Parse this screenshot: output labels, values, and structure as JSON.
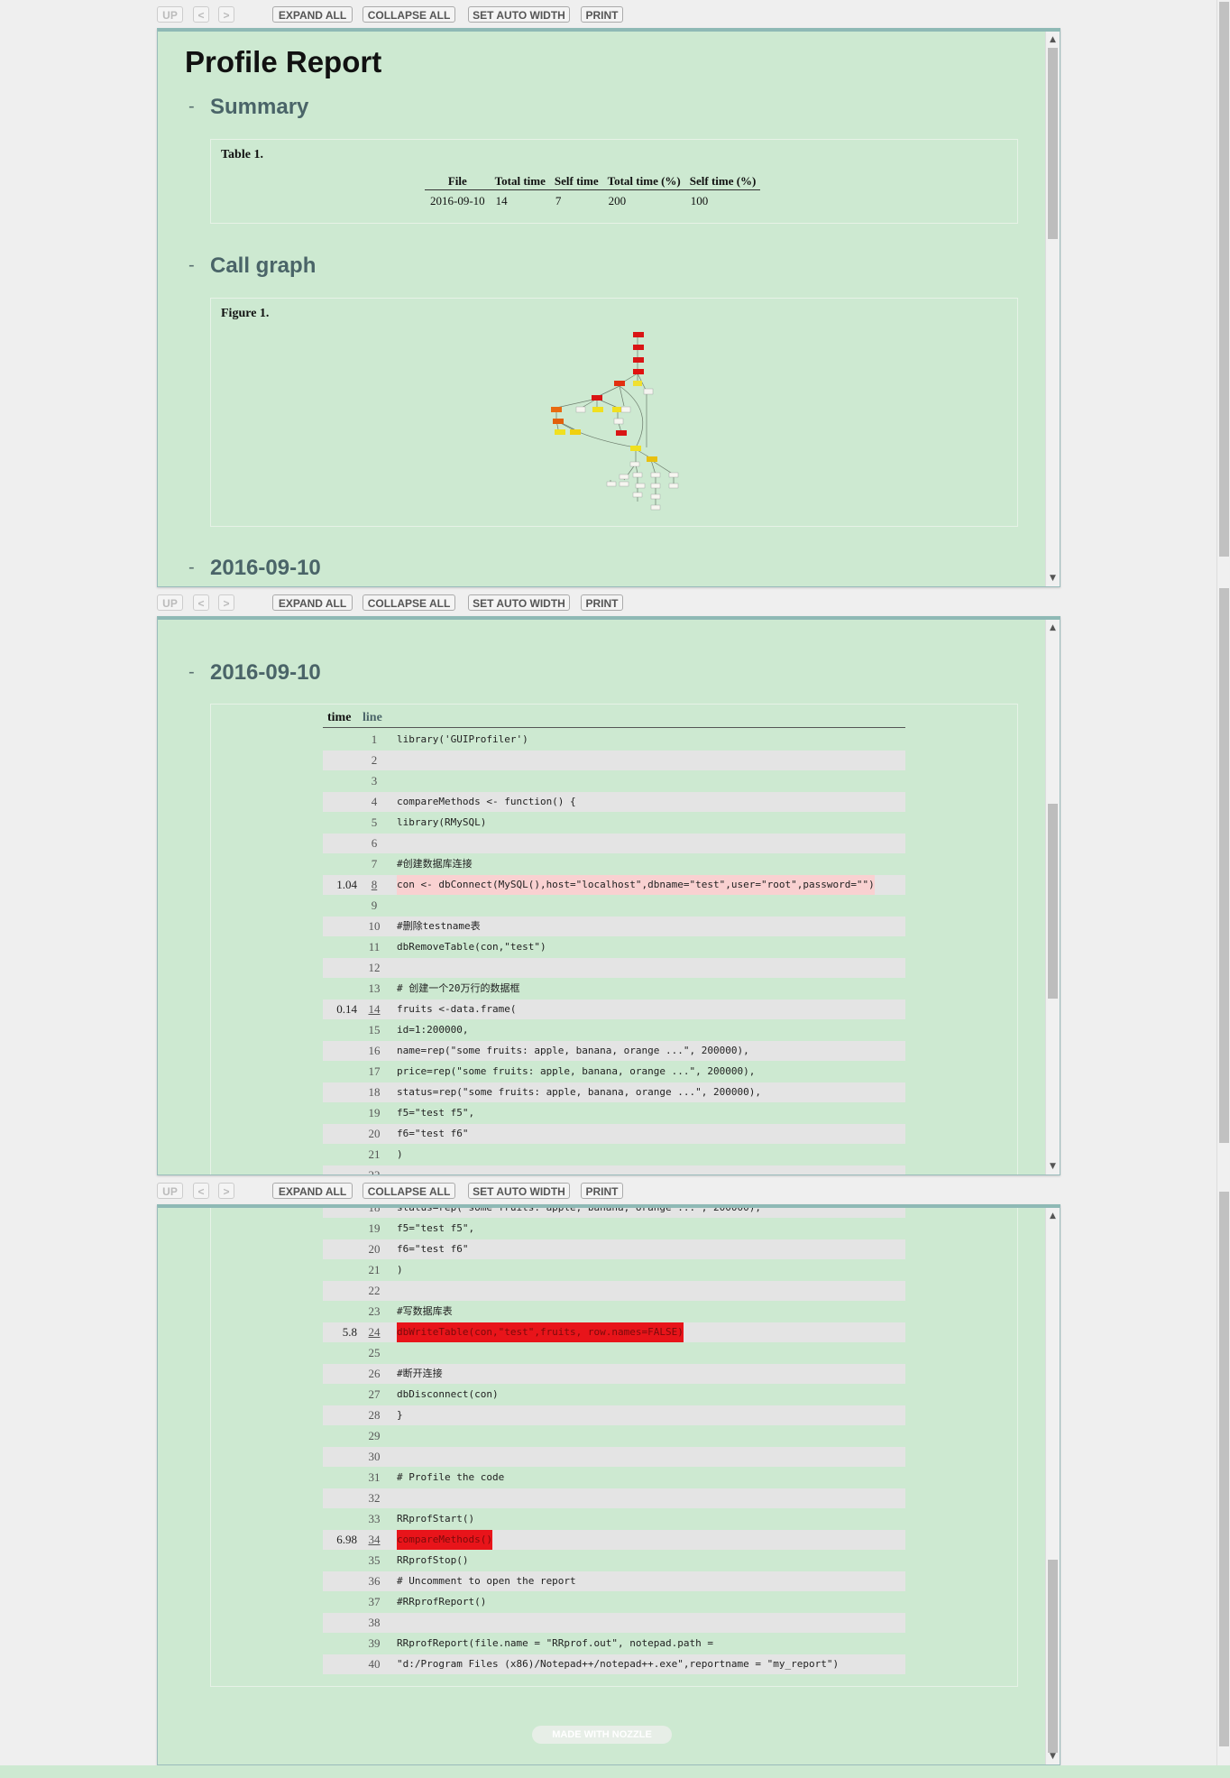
{
  "toolbar": {
    "up": "UP",
    "prev": "<",
    "next": ">",
    "expand_all": "EXPAND ALL",
    "collapse_all": "COLLAPSE ALL",
    "set_auto_width": "SET AUTO WIDTH",
    "print": "PRINT"
  },
  "report": {
    "title": "Profile Report",
    "summary_title": "Summary",
    "table_caption": "Table 1.",
    "table_headers": [
      "File",
      "Total time",
      "Self time",
      "Total time (%)",
      "Self time (%)"
    ],
    "table_row": [
      "2016-09-10",
      "14",
      "7",
      "200",
      "100"
    ],
    "callgraph_title": "Call graph",
    "figure_caption": "Figure 1.",
    "file_section_title": "2016-09-10",
    "collapse_symbol": "-"
  },
  "code": {
    "col_time": "time",
    "col_line": "line",
    "lines": [
      {
        "n": "1",
        "t": "",
        "code": "library('GUIProfiler')"
      },
      {
        "n": "2",
        "t": "",
        "code": ""
      },
      {
        "n": "3",
        "t": "",
        "code": ""
      },
      {
        "n": "4",
        "t": "",
        "code": "compareMethods <- function() {"
      },
      {
        "n": "5",
        "t": "",
        "code": "library(RMySQL)"
      },
      {
        "n": "6",
        "t": "",
        "code": ""
      },
      {
        "n": "7",
        "t": "",
        "code": "#创建数据库连接"
      },
      {
        "n": "8",
        "t": "1.04",
        "code": "con <- dbConnect(MySQL(),host=\"localhost\",dbname=\"test\",user=\"root\",password=\"\")"
      },
      {
        "n": "9",
        "t": "",
        "code": ""
      },
      {
        "n": "10",
        "t": "",
        "code": "#删除testname表"
      },
      {
        "n": "11",
        "t": "",
        "code": "dbRemoveTable(con,\"test\")"
      },
      {
        "n": "12",
        "t": "",
        "code": ""
      },
      {
        "n": "13",
        "t": "",
        "code": "# 创建一个20万行的数据框"
      },
      {
        "n": "14",
        "t": "0.14",
        "code": "fruits <-data.frame("
      },
      {
        "n": "15",
        "t": "",
        "code": "id=1:200000,"
      },
      {
        "n": "16",
        "t": "",
        "code": "name=rep(\"some fruits: apple, banana, orange ...\", 200000),"
      },
      {
        "n": "17",
        "t": "",
        "code": "price=rep(\"some fruits: apple, banana, orange ...\", 200000),"
      },
      {
        "n": "18",
        "t": "",
        "code": "status=rep(\"some fruits: apple, banana, orange ...\", 200000),"
      },
      {
        "n": "19",
        "t": "",
        "code": "f5=\"test f5\","
      },
      {
        "n": "20",
        "t": "",
        "code": "f6=\"test f6\""
      },
      {
        "n": "21",
        "t": "",
        "code": ")"
      },
      {
        "n": "22",
        "t": "",
        "code": ""
      },
      {
        "n": "23",
        "t": "",
        "code": "#写数据库表"
      },
      {
        "n": "24",
        "t": "5.8",
        "code": "dbWriteTable(con,\"test\",fruits, row.names=FALSE)"
      },
      {
        "n": "25",
        "t": "",
        "code": ""
      },
      {
        "n": "26",
        "t": "",
        "code": "#断开连接"
      },
      {
        "n": "27",
        "t": "",
        "code": "dbDisconnect(con)"
      },
      {
        "n": "28",
        "t": "",
        "code": "}"
      },
      {
        "n": "29",
        "t": "",
        "code": ""
      },
      {
        "n": "30",
        "t": "",
        "code": ""
      },
      {
        "n": "31",
        "t": "",
        "code": "# Profile the code"
      },
      {
        "n": "32",
        "t": "",
        "code": ""
      },
      {
        "n": "33",
        "t": "",
        "code": "RRprofStart()"
      },
      {
        "n": "34",
        "t": "6.98",
        "code": "compareMethods()"
      },
      {
        "n": "35",
        "t": "",
        "code": "RRprofStop()"
      },
      {
        "n": "36",
        "t": "",
        "code": "# Uncomment to open the report"
      },
      {
        "n": "37",
        "t": "",
        "code": "#RRprofReport()"
      },
      {
        "n": "38",
        "t": "",
        "code": ""
      },
      {
        "n": "39",
        "t": "",
        "code": "RRprofReport(file.name = \"RRprof.out\", notepad.path ="
      },
      {
        "n": "40",
        "t": "",
        "code": "\"d:/Program Files (x86)/Notepad++/notepad++.exe\",reportname = \"my_report\")"
      }
    ]
  },
  "footer": {
    "made_with": "MADE WITH NOZZLE"
  },
  "colors": {
    "panel_bg": "#cde9d1",
    "hot": "#e8141a",
    "warm": "#f9d1d1",
    "heading": "#4a6468"
  }
}
